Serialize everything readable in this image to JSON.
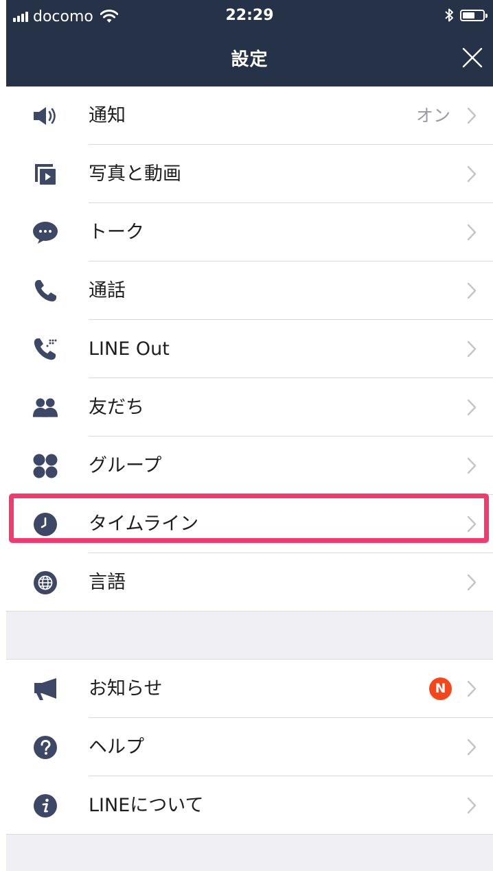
{
  "status_bar": {
    "carrier": "docomo",
    "time": "22:29",
    "icons": [
      "signal-icon",
      "wifi-icon",
      "bluetooth-icon",
      "battery-icon"
    ]
  },
  "nav": {
    "title": "設定",
    "close_icon": "close-icon"
  },
  "section1": [
    {
      "id": "notifications",
      "label": "通知",
      "value": "オン",
      "icon": "speaker-icon"
    },
    {
      "id": "photos-videos",
      "label": "写真と動画",
      "icon": "media-play-icon"
    },
    {
      "id": "talk",
      "label": "トーク",
      "icon": "chat-bubble-icon"
    },
    {
      "id": "calls",
      "label": "通話",
      "icon": "phone-icon"
    },
    {
      "id": "line-out",
      "label": "LINE Out",
      "icon": "phone-out-icon"
    },
    {
      "id": "friends",
      "label": "友だち",
      "icon": "friends-icon"
    },
    {
      "id": "groups",
      "label": "グループ",
      "icon": "groups-icon"
    },
    {
      "id": "timeline",
      "label": "タイムライン",
      "icon": "clock-icon",
      "highlighted": true
    },
    {
      "id": "language",
      "label": "言語",
      "icon": "globe-icon"
    }
  ],
  "section2": [
    {
      "id": "announcements",
      "label": "お知らせ",
      "badge": "N",
      "icon": "megaphone-icon"
    },
    {
      "id": "help",
      "label": "ヘルプ",
      "icon": "help-icon"
    },
    {
      "id": "about",
      "label": "LINEについて",
      "icon": "info-icon"
    }
  ],
  "colors": {
    "nav_background": "#263248",
    "icon": "#3c4866",
    "highlight_border": "#f23a6f",
    "badge": "#f7451a",
    "group_background": "#efeff4"
  }
}
